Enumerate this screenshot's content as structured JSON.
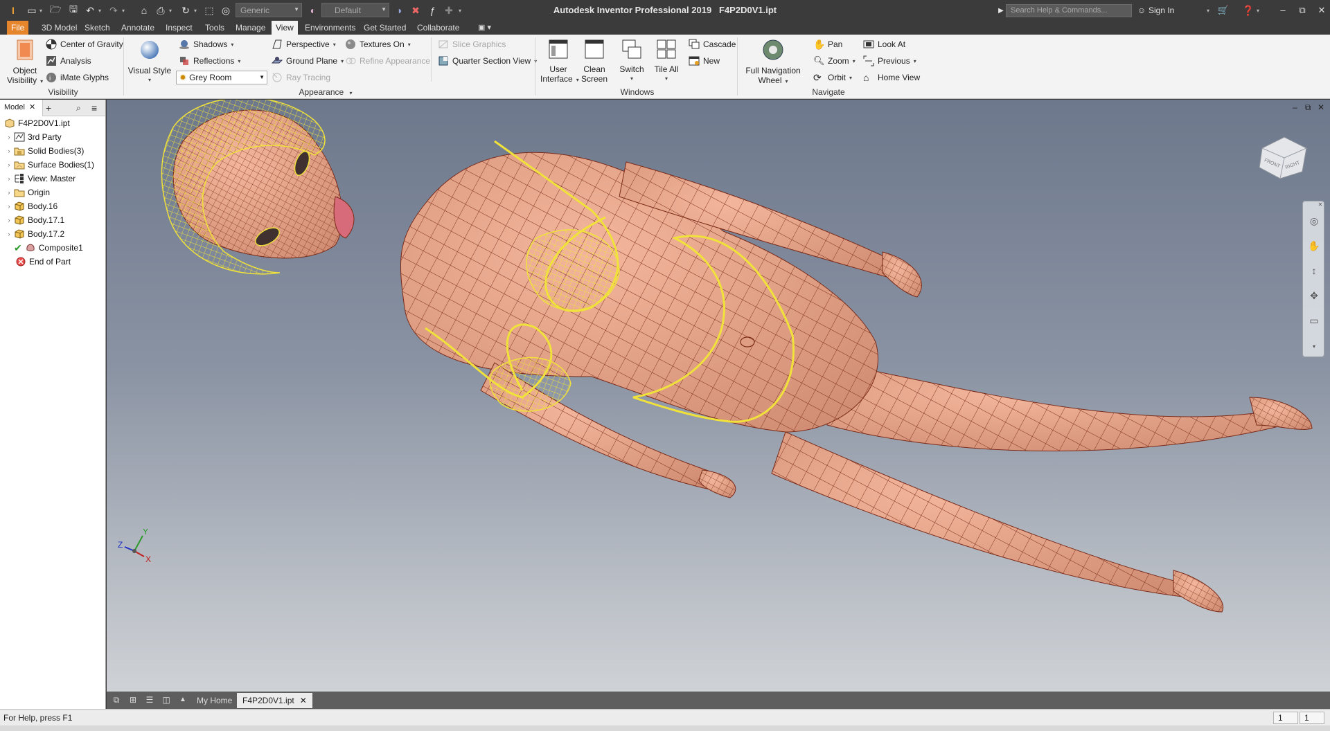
{
  "window": {
    "app_name": "Autodesk Inventor Professional 2019",
    "document": "F4P2D0V1.ipt"
  },
  "quick_access": {
    "material_combo": "Generic",
    "appearance_combo": "Default",
    "search_placeholder": "Search Help & Commands...",
    "sign_in": "Sign In"
  },
  "ribbon_tabs": [
    "File",
    "3D Model",
    "Sketch",
    "Annotate",
    "Inspect",
    "Tools",
    "Manage",
    "View",
    "Environments",
    "Get Started",
    "Collaborate"
  ],
  "active_tab": "View",
  "ribbon": {
    "visibility": {
      "object_visibility_line1": "Object",
      "object_visibility_line2": "Visibility",
      "center_of_gravity": "Center of Gravity",
      "analysis": "Analysis",
      "imate_glyphs": "iMate Glyphs",
      "label": "Visibility"
    },
    "appearance": {
      "visual_style": "Visual Style",
      "shadows": "Shadows",
      "reflections": "Reflections",
      "lighting_style": "Grey Room",
      "perspective": "Perspective",
      "ground_plane": "Ground Plane",
      "ray_tracing": "Ray Tracing",
      "textures_on": "Textures On",
      "refine_appearance": "Refine Appearance",
      "slice_graphics": "Slice Graphics",
      "quarter_section_view": "Quarter Section View",
      "label": "Appearance"
    },
    "windows": {
      "user_interface_line1": "User",
      "user_interface_line2": "Interface",
      "clean_screen_line1": "Clean",
      "clean_screen_line2": "Screen",
      "switch": "Switch",
      "tile_all": "Tile All",
      "cascade": "Cascade",
      "new": "New",
      "label": "Windows"
    },
    "navigate": {
      "full_nav_wheel_line1": "Full Navigation",
      "full_nav_wheel_line2": "Wheel",
      "pan": "Pan",
      "zoom": "Zoom",
      "orbit": "Orbit",
      "look_at": "Look At",
      "previous": "Previous",
      "home_view": "Home View",
      "label": "Navigate"
    }
  },
  "browser": {
    "tab": "Model",
    "root": "F4P2D0V1.ipt",
    "items": [
      {
        "label": "3rd Party",
        "expandable": true,
        "icon": "third-party-icon"
      },
      {
        "label": "Solid Bodies(3)",
        "expandable": true,
        "icon": "solid-bodies-icon"
      },
      {
        "label": "Surface Bodies(1)",
        "expandable": true,
        "icon": "surface-bodies-icon"
      },
      {
        "label": "View: Master",
        "expandable": true,
        "icon": "view-rep-icon"
      },
      {
        "label": "Origin",
        "expandable": true,
        "icon": "origin-folder-icon"
      },
      {
        "label": "Body.16",
        "expandable": true,
        "icon": "body-icon"
      },
      {
        "label": "Body.17.1",
        "expandable": true,
        "icon": "body-icon"
      },
      {
        "label": "Body.17.2",
        "expandable": true,
        "icon": "body-icon"
      },
      {
        "label": "Composite1",
        "expandable": false,
        "icon": "composite-icon"
      },
      {
        "label": "End of Part",
        "expandable": false,
        "icon": "end-of-part-icon"
      }
    ]
  },
  "viewcube": {
    "front": "FRONT",
    "right": "RIGHT"
  },
  "triad": {
    "x": "X",
    "y": "Y",
    "z": "Z"
  },
  "doc_tabs": {
    "home": "My Home",
    "active": "F4P2D0V1.ipt"
  },
  "status": {
    "text": "For Help, press F1",
    "cell1": "1",
    "cell2": "1"
  },
  "colors": {
    "file_tab": "#e5862c",
    "skin": "#e9a88f",
    "wire": "#7a2a18",
    "bikini_wire": "#f0e23a"
  }
}
